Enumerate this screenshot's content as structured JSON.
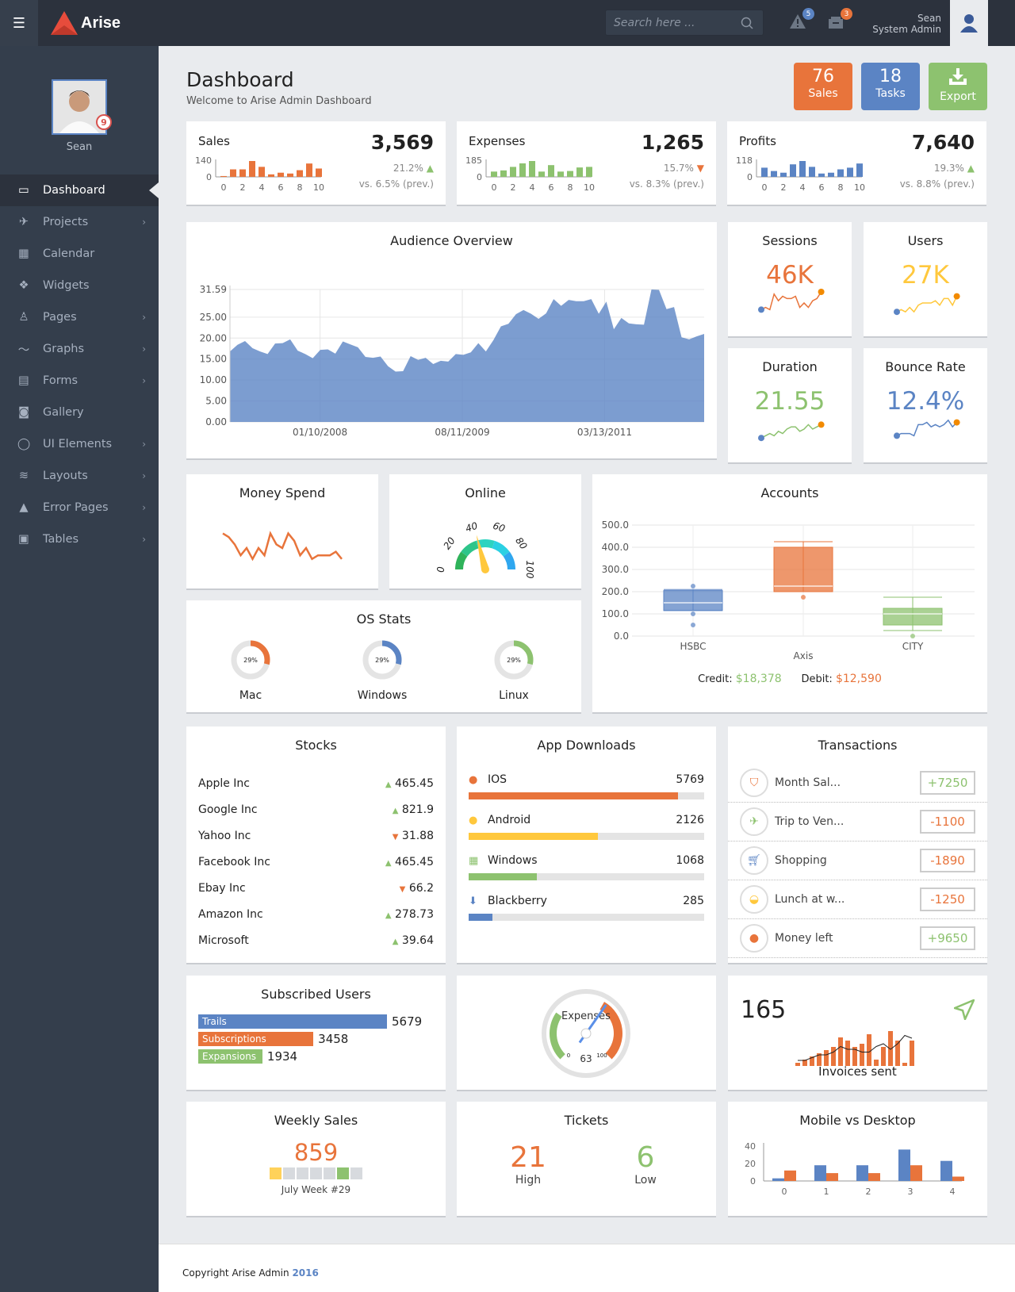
{
  "header": {
    "brand": "Arise",
    "search_placeholder": "Search here ...",
    "alerts_count": "5",
    "messages_count": "3",
    "user_name": "Sean",
    "user_role": "System Admin"
  },
  "sidebar": {
    "profile_name": "Sean",
    "profile_badge": "9",
    "items": [
      {
        "label": "Dashboard",
        "icon": "monitor-icon",
        "has_submenu": false,
        "active": true
      },
      {
        "label": "Projects",
        "icon": "rocket-icon",
        "has_submenu": true
      },
      {
        "label": "Calendar",
        "icon": "calendar-icon",
        "has_submenu": false
      },
      {
        "label": "Widgets",
        "icon": "widgets-icon",
        "has_submenu": false
      },
      {
        "label": "Pages",
        "icon": "user-icon",
        "has_submenu": true
      },
      {
        "label": "Graphs",
        "icon": "graph-icon",
        "has_submenu": true
      },
      {
        "label": "Forms",
        "icon": "layout-icon",
        "has_submenu": true
      },
      {
        "label": "Gallery",
        "icon": "camera-icon",
        "has_submenu": false
      },
      {
        "label": "UI Elements",
        "icon": "drop-icon",
        "has_submenu": true
      },
      {
        "label": "Layouts",
        "icon": "layers-icon",
        "has_submenu": true
      },
      {
        "label": "Error Pages",
        "icon": "warning-icon",
        "has_submenu": true
      },
      {
        "label": "Tables",
        "icon": "grid-icon",
        "has_submenu": true
      }
    ]
  },
  "page": {
    "title": "Dashboard",
    "subtitle": "Welcome to Arise Admin Dashboard"
  },
  "quick": {
    "sales_num": "76",
    "sales_label": "Sales",
    "tasks_num": "18",
    "tasks_label": "Tasks",
    "export_label": "Export"
  },
  "stats": [
    {
      "title": "Sales",
      "value": "3,569",
      "pct": "21.2%",
      "trend": "up",
      "prev": "vs. 6.5% (prev.)",
      "ymax_label": "140",
      "color": "#e8743b",
      "bars": [
        5,
        45,
        45,
        95,
        60,
        15,
        25,
        20,
        40,
        80,
        50
      ]
    },
    {
      "title": "Expenses",
      "value": "1,265",
      "pct": "15.7%",
      "trend": "down",
      "prev": "vs. 8.3% (prev.)",
      "ymax_label": "185",
      "color": "#8dc26f",
      "bars": [
        45,
        55,
        85,
        115,
        135,
        45,
        100,
        45,
        50,
        80,
        85
      ]
    },
    {
      "title": "Profits",
      "value": "7,640",
      "pct": "19.3%",
      "trend": "up",
      "prev": "vs. 8.8% (prev.)",
      "ymax_label": "118",
      "color": "#5b84c4",
      "bars": [
        55,
        35,
        25,
        75,
        95,
        60,
        20,
        25,
        45,
        55,
        80
      ]
    }
  ],
  "stats_xticks": [
    "0",
    "2",
    "4",
    "6",
    "8",
    "10"
  ],
  "audience": {
    "title": "Audience Overview"
  },
  "chart_data": {
    "type": "area",
    "title": "Audience Overview",
    "ylim": [
      0,
      31.59
    ],
    "yticks": [
      "0.00",
      "5.00",
      "10.00",
      "15.00",
      "20.00",
      "25.00",
      "31.59"
    ],
    "xticks": [
      "01/10/2008",
      "08/11/2009",
      "03/13/2011"
    ],
    "values": [
      16.8,
      18.4,
      19.3,
      17.6,
      16.8,
      16.2,
      18.7,
      18.8,
      19.7,
      17,
      16.2,
      15.2,
      17.2,
      17.3,
      16.3,
      19.2,
      18.5,
      17.8,
      15.5,
      15.3,
      15.6,
      13.3,
      12,
      12.1,
      15.7,
      14.8,
      15.3,
      13.8,
      14.6,
      14.4,
      16.2,
      16,
      16.6,
      18.8,
      16.8,
      19.5,
      22.8,
      23.4,
      25.7,
      26.7,
      25.8,
      24.6,
      25.9,
      29.3,
      27.7,
      29.1,
      28.8,
      28.8,
      29.3,
      25.8,
      28.7,
      22.1,
      24.8,
      23.5,
      23.3,
      23.2,
      31.6,
      31.5,
      26.9,
      27.4,
      20.2,
      19.7,
      20.4,
      21
    ]
  },
  "kpis": [
    {
      "title": "Sessions",
      "value": "46K",
      "color": "#e8743b",
      "line": [
        2,
        3,
        2,
        9,
        6,
        8,
        7,
        7,
        8,
        3,
        5,
        3,
        6,
        7,
        10
      ]
    },
    {
      "title": "Users",
      "value": "27K",
      "color": "#ffc83d",
      "line": [
        1,
        2,
        1,
        3,
        1,
        4,
        5,
        5,
        5,
        6,
        4,
        7,
        7,
        4,
        8
      ]
    },
    {
      "title": "Duration",
      "value": "21.55",
      "color": "#8dc26f",
      "line": [
        1,
        2,
        3,
        2,
        4,
        3,
        5,
        6,
        6,
        4,
        5,
        7,
        5,
        6,
        7
      ]
    },
    {
      "title": "Bounce Rate",
      "value": "12.4%",
      "color": "#5b84c4",
      "line": [
        2,
        3,
        3,
        3,
        2,
        7,
        7,
        8,
        6,
        7,
        6,
        7,
        9,
        6,
        8
      ]
    }
  ],
  "money_spend": {
    "title": "Money Spend",
    "values": [
      9,
      8,
      6,
      3,
      5,
      2,
      5,
      3,
      9,
      6,
      5,
      9,
      7,
      3,
      5,
      2,
      3,
      3,
      3,
      4,
      2
    ]
  },
  "online": {
    "title": "Online",
    "value": 42,
    "ticks": [
      "0",
      "20",
      "40",
      "60",
      "80",
      "100"
    ]
  },
  "os": {
    "title": "OS Stats",
    "items": [
      {
        "label": "Mac",
        "pct": "29%",
        "value": 29,
        "color": "#e8743b"
      },
      {
        "label": "Windows",
        "pct": "29%",
        "value": 29,
        "color": "#5b84c4"
      },
      {
        "label": "Linux",
        "pct": "29%",
        "value": 29,
        "color": "#8dc26f"
      }
    ]
  },
  "accounts": {
    "title": "Accounts",
    "credit_label": "Credit:",
    "credit": "$18,378",
    "debit_label": "Debit:",
    "debit": "$12,590",
    "yticks": [
      "0.0",
      "100.0",
      "200.0",
      "300.0",
      "400.0",
      "500.0"
    ],
    "x_label": "Axis",
    "boxes": [
      {
        "name": "HSBC",
        "color": "#5b84c4",
        "q1": 115,
        "median": 150,
        "q3": 205,
        "low": 115,
        "high": 210,
        "outliers": [
          225,
          100,
          50
        ]
      },
      {
        "name": "",
        "color": "#e8743b",
        "q1": 200,
        "median": 225,
        "q3": 400,
        "low": 200,
        "high": 425,
        "outliers": [
          175
        ]
      },
      {
        "name": "CITY",
        "color": "#8dc26f",
        "q1": 50,
        "median": 100,
        "q3": 125,
        "low": 25,
        "high": 175,
        "outliers": [
          0
        ]
      }
    ]
  },
  "stocks": {
    "title": "Stocks",
    "rows": [
      {
        "name": "Apple Inc",
        "value": "465.45",
        "trend": "up"
      },
      {
        "name": "Google Inc",
        "value": "821.9",
        "trend": "up"
      },
      {
        "name": "Yahoo Inc",
        "value": "31.88",
        "trend": "down"
      },
      {
        "name": "Facebook Inc",
        "value": "465.45",
        "trend": "up"
      },
      {
        "name": "Ebay Inc",
        "value": "66.2",
        "trend": "down"
      },
      {
        "name": "Amazon Inc",
        "value": "278.73",
        "trend": "up"
      },
      {
        "name": "Microsoft",
        "value": "39.64",
        "trend": "up"
      }
    ]
  },
  "downloads": {
    "title": "App Downloads",
    "rows": [
      {
        "name": "IOS",
        "value": "5769",
        "pct": 89,
        "color": "#e8743b",
        "icon": "apple-icon"
      },
      {
        "name": "Android",
        "value": "2126",
        "pct": 55,
        "color": "#ffc83d",
        "icon": "android-icon"
      },
      {
        "name": "Windows",
        "value": "1068",
        "pct": 29,
        "color": "#8dc26f",
        "icon": "windows-icon"
      },
      {
        "name": "Blackberry",
        "value": "285",
        "pct": 10,
        "color": "#5b84c4",
        "icon": "download-icon"
      }
    ]
  },
  "transactions": {
    "title": "Transactions",
    "rows": [
      {
        "label": "Month Sal...",
        "amount": "+7250",
        "positive": true,
        "icon": "shield-icon",
        "color": "#e8743b"
      },
      {
        "label": "Trip to Ven...",
        "amount": "-1100",
        "positive": false,
        "icon": "plane-icon",
        "color": "#8dc26f"
      },
      {
        "label": "Shopping",
        "amount": "-1890",
        "positive": false,
        "icon": "cart-icon",
        "color": "#5b84c4"
      },
      {
        "label": "Lunch at w...",
        "amount": "-1250",
        "positive": false,
        "icon": "bowl-icon",
        "color": "#ffc83d"
      },
      {
        "label": "Money left",
        "amount": "+9650",
        "positive": true,
        "icon": "piggy-icon",
        "color": "#e8743b"
      }
    ]
  },
  "subscribed": {
    "title": "Subscribed Users",
    "rows": [
      {
        "label": "Trails",
        "value": "5679",
        "pct": 100,
        "color": "#5b84c4"
      },
      {
        "label": "Subscriptions",
        "value": "3458",
        "pct": 61,
        "color": "#e8743b"
      },
      {
        "label": "Expansions",
        "value": "1934",
        "pct": 34,
        "color": "#8dc26f"
      }
    ]
  },
  "expenses_gauge": {
    "label": "Expenses",
    "value": "63",
    "min": "0",
    "max": "100"
  },
  "invoices": {
    "value": "165",
    "label": "Invoices sent",
    "bars": [
      1,
      2,
      3,
      4,
      5,
      6,
      9,
      8,
      6,
      7,
      10,
      2,
      6,
      11,
      8,
      1,
      8
    ],
    "line": [
      2,
      2,
      3,
      4,
      4,
      5,
      7,
      6,
      6,
      5,
      5,
      7,
      8,
      6,
      8,
      11,
      10
    ]
  },
  "weekly": {
    "title": "Weekly Sales",
    "value": "859",
    "week": "July Week #29",
    "days": [
      "#ffd25a",
      "#d7dade",
      "#d7dade",
      "#d7dade",
      "#d7dade",
      "#8dc26f",
      "#d7dade"
    ]
  },
  "tickets": {
    "title": "Tickets",
    "high": "21",
    "high_label": "High",
    "low": "6",
    "low_label": "Low"
  },
  "mvd": {
    "title": "Mobile vs Desktop",
    "yticks": [
      "0",
      "20",
      "40"
    ],
    "xticks": [
      "0",
      "1",
      "2",
      "3",
      "4"
    ],
    "mobile": [
      3,
      18,
      18,
      36,
      23
    ],
    "desktop": [
      12,
      9,
      9,
      18,
      5
    ]
  },
  "footer": {
    "text": "Copyright Arise Admin",
    "year": "2016"
  }
}
